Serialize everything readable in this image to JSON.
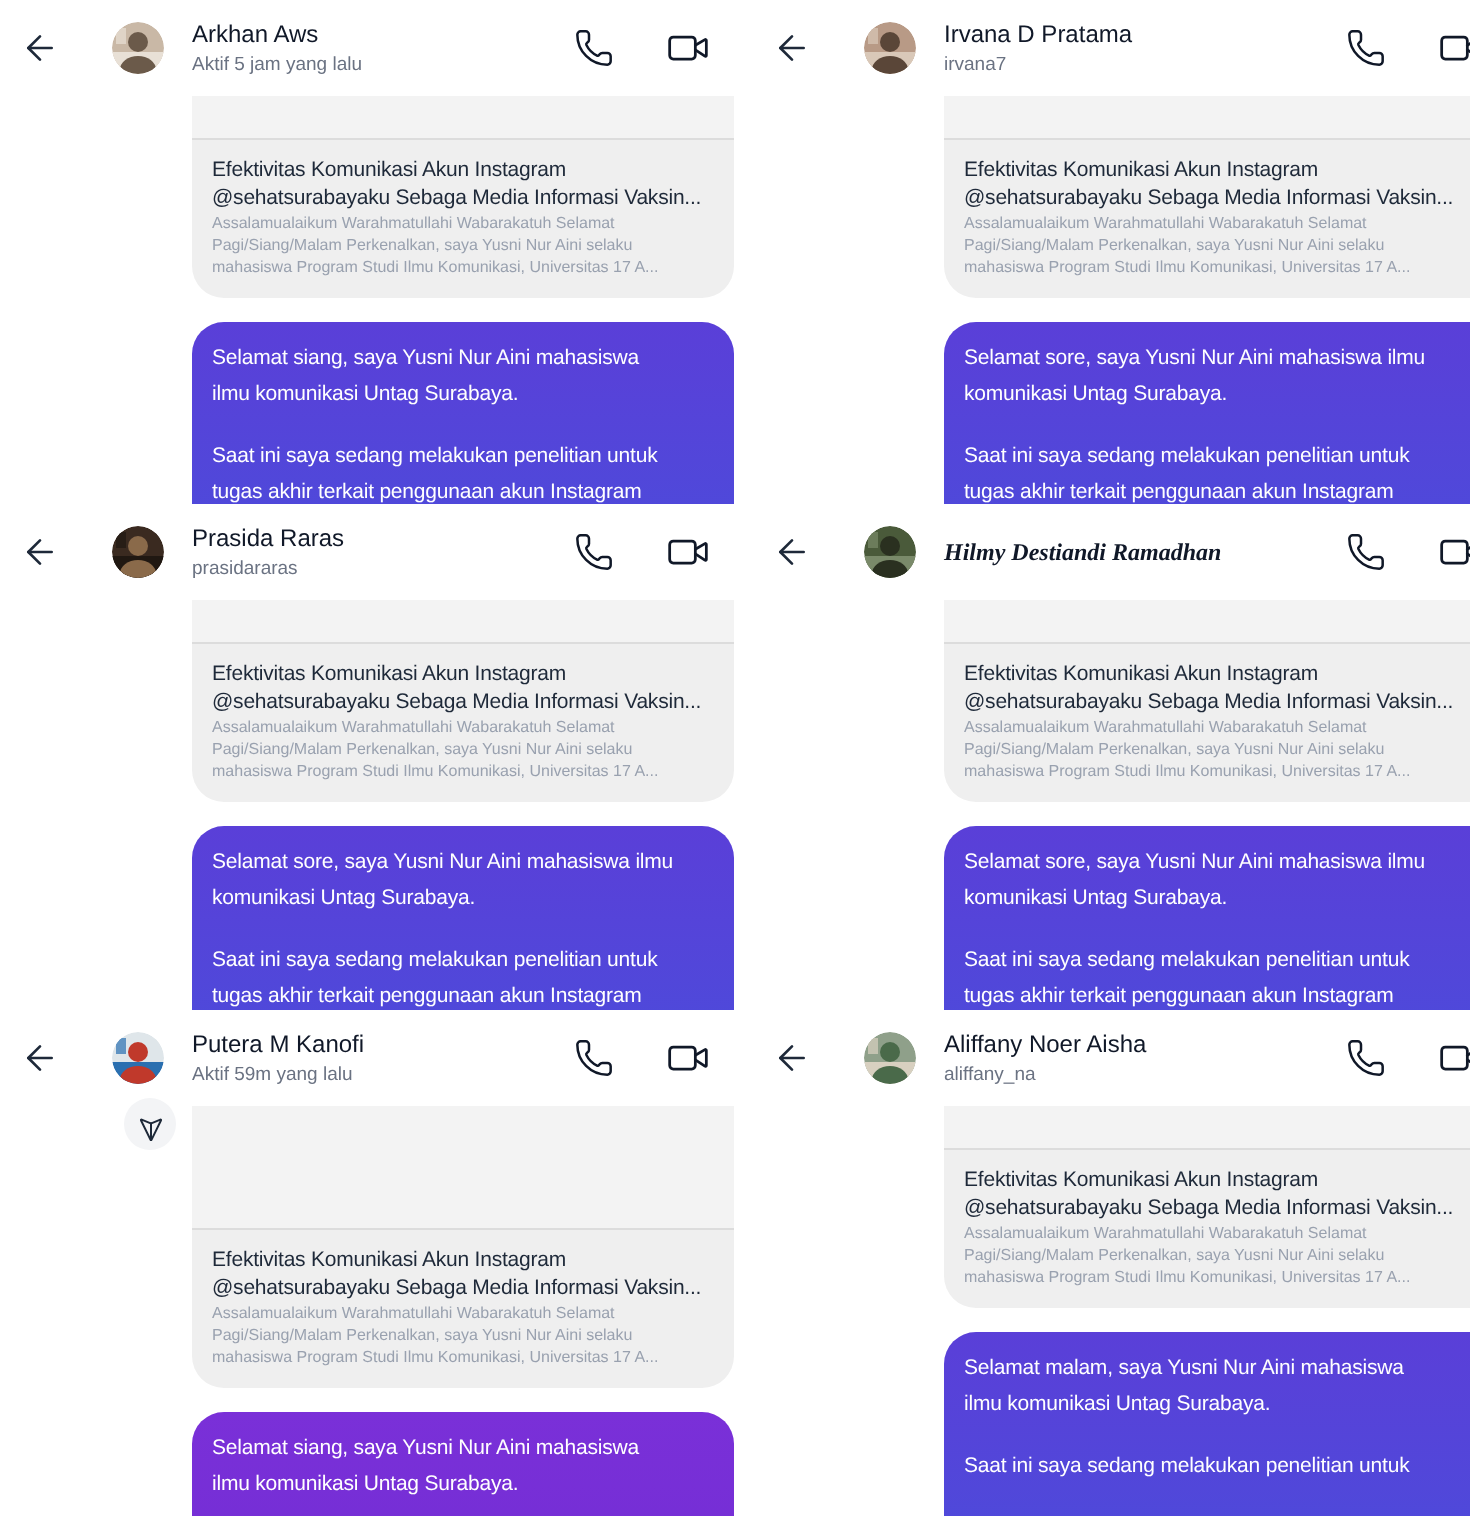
{
  "chats": [
    {
      "name": "Arkhan Aws",
      "kind": "plain",
      "subtitle": "Aktif 5 jam yang lalu",
      "share_button": false,
      "card": {
        "title": [
          "Efektivitas Komunikasi Akun Instagram",
          "@sehatsurabayaku Sebaga Media Informasi Vaksin..."
        ],
        "description": [
          "Assalamualaikum Warahmatullahi Wabarakatuh Selamat",
          "Pagi/Siang/Malam Perkenalkan, saya Yusni Nur Aini selaku",
          "mahasiswa Program Studi Ilmu Komunikasi, Universitas 17 A..."
        ]
      },
      "message": [
        [
          "Selamat siang, saya Yusni Nur Aini mahasiswa",
          "ilmu komunikasi Untag Surabaya."
        ],
        [
          "Saat ini saya sedang melakukan penelitian untuk",
          "tugas akhir terkait penggunaan akun Instagram"
        ]
      ]
    },
    {
      "name": "Irvana D Pratama",
      "kind": "plain",
      "subtitle": "irvana7",
      "share_button": false,
      "card": {
        "title": [
          "Efektivitas Komunikasi Akun Instagram",
          "@sehatsurabayaku Sebaga Media Informasi Vaksin..."
        ],
        "description": [
          "Assalamualaikum Warahmatullahi Wabarakatuh Selamat",
          "Pagi/Siang/Malam Perkenalkan, saya Yusni Nur Aini selaku",
          "mahasiswa Program Studi Ilmu Komunikasi, Universitas 17 A..."
        ]
      },
      "message": [
        [
          "Selamat sore, saya Yusni Nur Aini mahasiswa ilmu",
          "komunikasi Untag Surabaya."
        ],
        [
          "Saat ini saya sedang melakukan penelitian untuk",
          "tugas akhir terkait penggunaan akun Instagram"
        ]
      ]
    },
    {
      "name": "Prasida Raras",
      "kind": "plain",
      "subtitle": "prasidararas",
      "share_button": false,
      "card": {
        "title": [
          "Efektivitas Komunikasi Akun Instagram",
          "@sehatsurabayaku Sebaga Media Informasi Vaksin..."
        ],
        "description": [
          "Assalamualaikum Warahmatullahi Wabarakatuh Selamat",
          "Pagi/Siang/Malam Perkenalkan, saya Yusni Nur Aini selaku",
          "mahasiswa Program Studi Ilmu Komunikasi, Universitas 17 A..."
        ]
      },
      "message": [
        [
          "Selamat sore, saya Yusni Nur Aini mahasiswa ilmu",
          "komunikasi Untag Surabaya."
        ],
        [
          "Saat ini saya sedang melakukan penelitian untuk",
          "tugas akhir terkait penggunaan akun Instagram"
        ]
      ]
    },
    {
      "name": "Hilmy Destiandi Ramadhan",
      "kind": "script",
      "share_button": false,
      "card": {
        "title": [
          "Efektivitas Komunikasi Akun Instagram",
          "@sehatsurabayaku Sebaga Media Informasi Vaksin..."
        ],
        "description": [
          "Assalamualaikum Warahmatullahi Wabarakatuh Selamat",
          "Pagi/Siang/Malam Perkenalkan, saya Yusni Nur Aini selaku",
          "mahasiswa Program Studi Ilmu Komunikasi, Universitas 17 A..."
        ]
      },
      "message": [
        [
          "Selamat sore, saya Yusni Nur Aini mahasiswa ilmu",
          "komunikasi Untag Surabaya."
        ],
        [
          "Saat ini saya sedang melakukan penelitian untuk",
          "tugas akhir terkait penggunaan akun Instagram"
        ]
      ]
    },
    {
      "name": "Putera M Kanofi",
      "kind": "plain",
      "subtitle": "Aktif 59m yang lalu",
      "share_button": true,
      "card": {
        "title": [
          "Efektivitas Komunikasi Akun Instagram",
          "@sehatsurabayaku Sebaga Media Informasi Vaksin..."
        ],
        "description": [
          "Assalamualaikum Warahmatullahi Wabarakatuh Selamat",
          "Pagi/Siang/Malam Perkenalkan, saya Yusni Nur Aini selaku",
          "mahasiswa Program Studi Ilmu Komunikasi, Universitas 17 A..."
        ]
      },
      "message": [
        [
          "Selamat siang, saya Yusni Nur Aini mahasiswa",
          "ilmu komunikasi Untag Surabaya."
        ]
      ]
    },
    {
      "name": "Aliffany Noer Aisha",
      "kind": "plain",
      "subtitle": "aliffany_na",
      "share_button": false,
      "card": {
        "title": [
          "Efektivitas Komunikasi Akun Instagram",
          "@sehatsurabayaku Sebaga Media Informasi Vaksin..."
        ],
        "description": [
          "Assalamualaikum Warahmatullahi Wabarakatuh Selamat",
          "Pagi/Siang/Malam Perkenalkan, saya Yusni Nur Aini selaku",
          "mahasiswa Program Studi Ilmu Komunikasi, Universitas 17 A..."
        ]
      },
      "message": [
        [
          "Selamat malam, saya Yusni Nur Aini mahasiswa",
          "ilmu komunikasi Untag Surabaya."
        ],
        [
          "Saat ini saya sedang melakukan penelitian untuk"
        ]
      ]
    }
  ]
}
